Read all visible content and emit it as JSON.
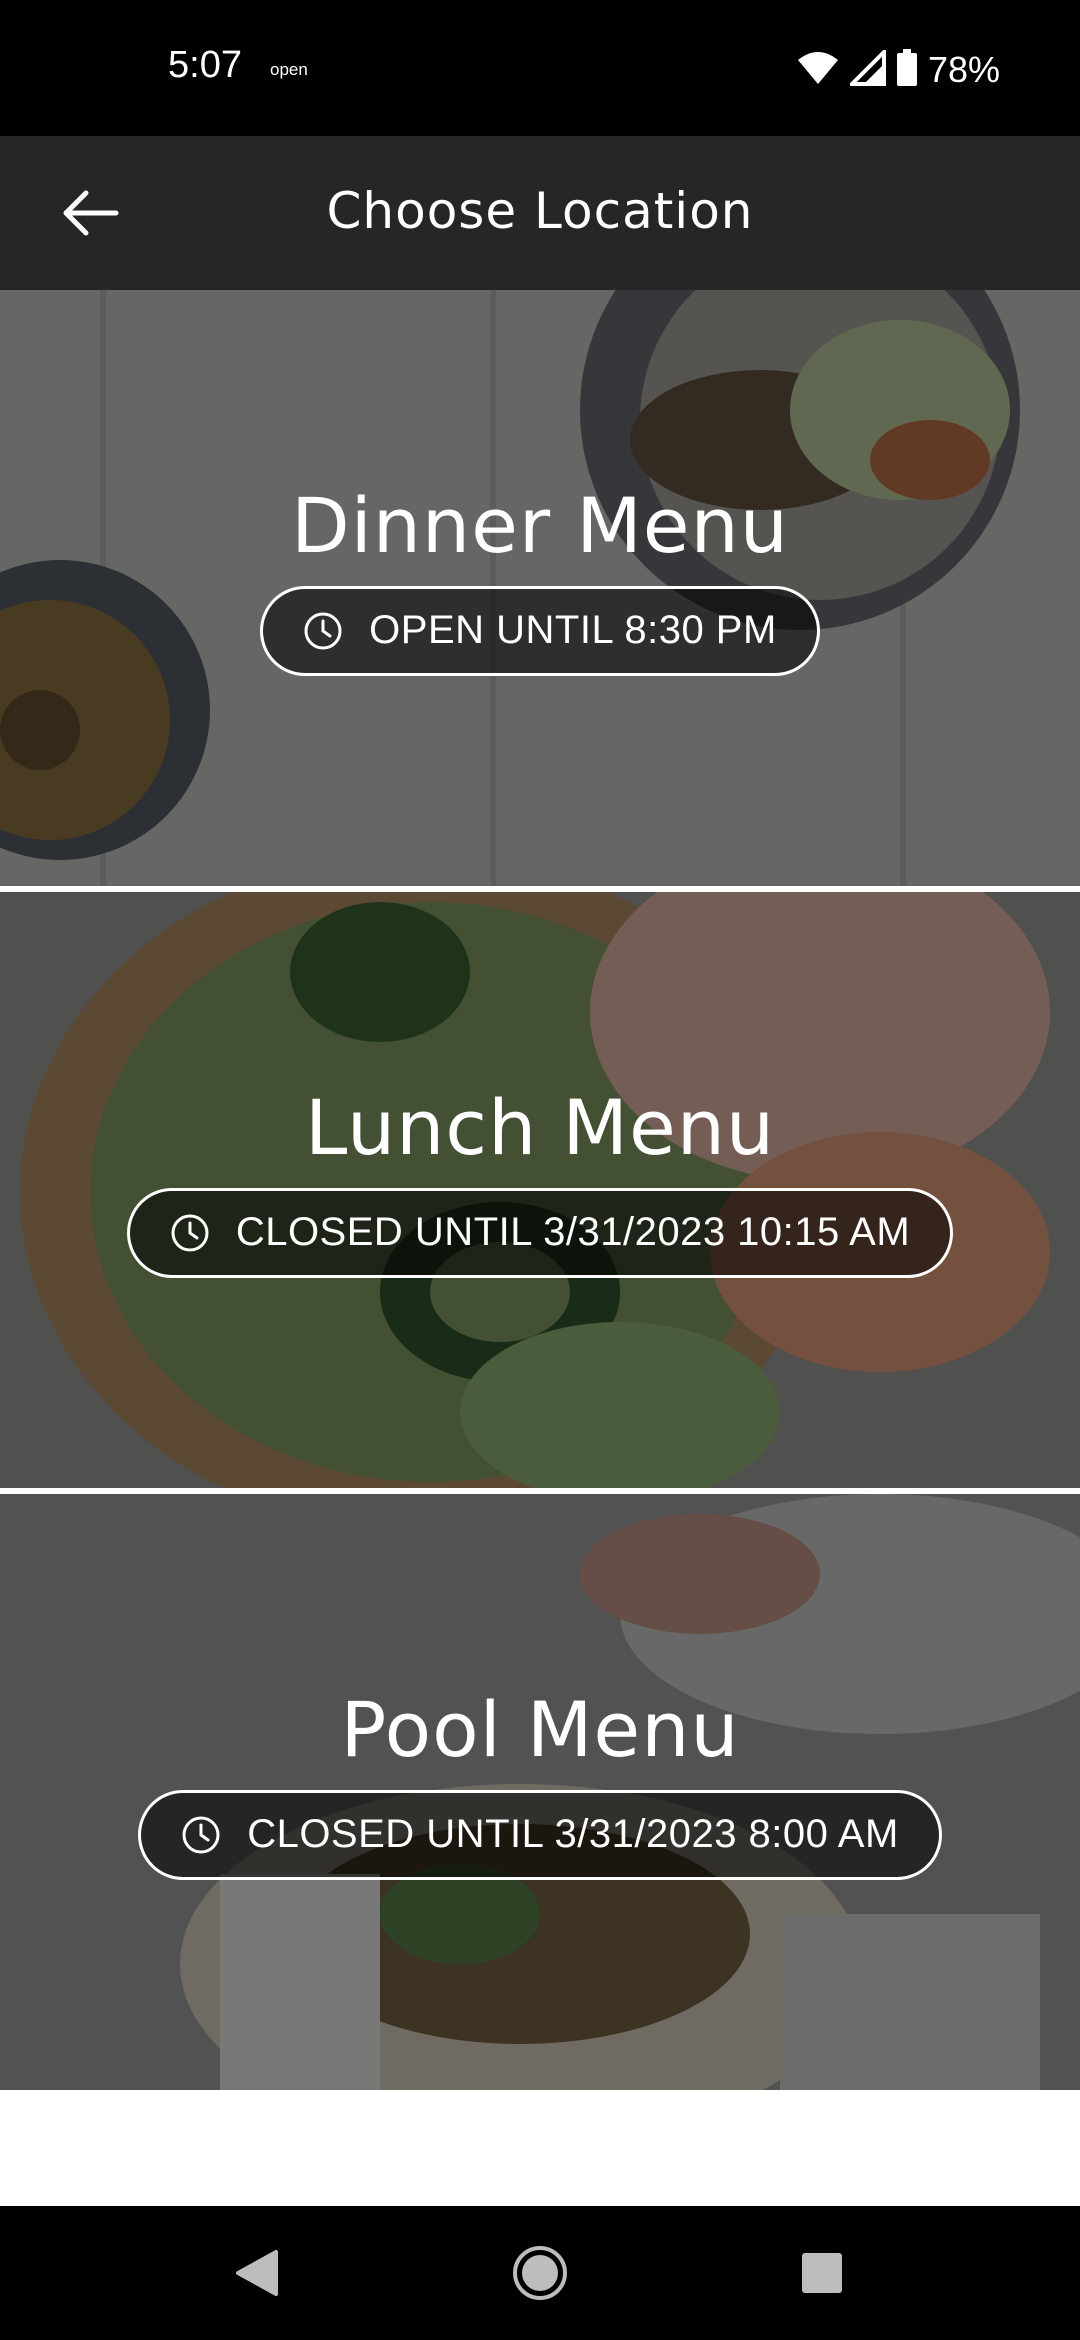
{
  "status_bar": {
    "time": "5:07",
    "notification_text": "open",
    "battery": "78%",
    "icons": [
      "wifi-icon",
      "signal-icon",
      "battery-icon"
    ]
  },
  "app_bar": {
    "title": "Choose Location",
    "back_icon": "arrow-left-icon"
  },
  "menus": [
    {
      "title": "Dinner Menu",
      "status": "OPEN UNTIL 8:30 PM",
      "status_icon": "clock-icon"
    },
    {
      "title": "Lunch Menu",
      "status": "CLOSED UNTIL 3/31/2023 10:15 AM",
      "status_icon": "clock-icon"
    },
    {
      "title": "Pool Menu",
      "status": "CLOSED UNTIL 3/31/2023 8:00 AM",
      "status_icon": "clock-icon"
    }
  ],
  "nav_bar": {
    "buttons": [
      "back-triangle-icon",
      "home-circle-icon",
      "recents-square-icon"
    ]
  },
  "colors": {
    "status_bar_bg": "#000000",
    "app_bar_bg": "#262626",
    "text": "#ffffff"
  }
}
